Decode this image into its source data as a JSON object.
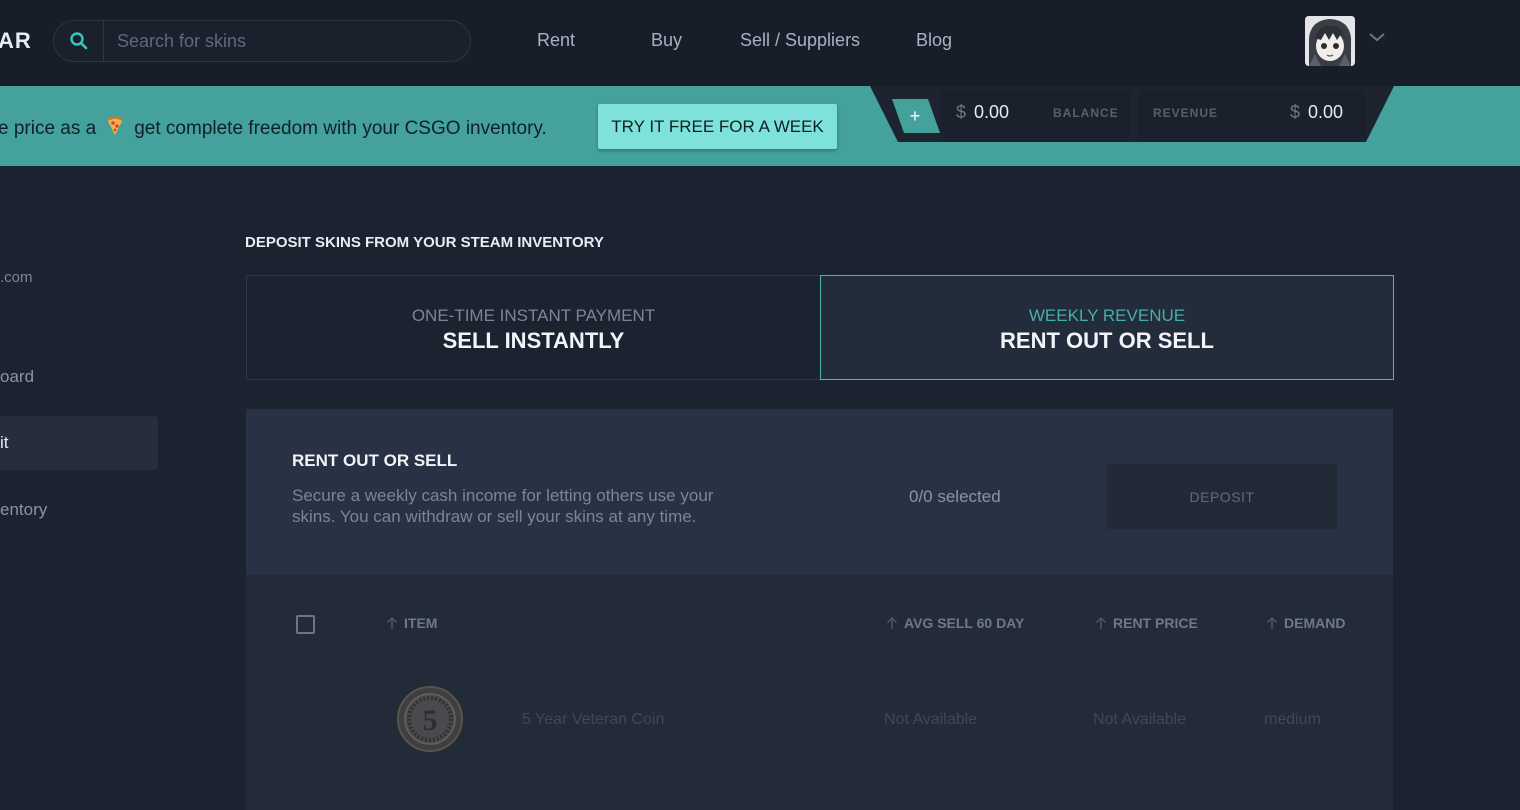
{
  "header": {
    "logo_text": "AR",
    "search_placeholder": "Search for skins",
    "nav": [
      "Rent",
      "Buy",
      "Sell / Suppliers",
      "Blog"
    ]
  },
  "promo": {
    "text_before": "e price as a",
    "text_after": "get complete freedom with your CSGO inventory.",
    "cta_label": "TRY IT FREE FOR A WEEK"
  },
  "wallet": {
    "currency": "$",
    "balance_amount": "0.00",
    "balance_label": "BALANCE",
    "revenue_label": "REVENUE",
    "revenue_amount": "0.00",
    "add_label": "+"
  },
  "sidebar": {
    "email_fragment": ".com",
    "items": [
      "oard",
      "it",
      "entory"
    ]
  },
  "main": {
    "section_title": "DEPOSIT SKINS FROM YOUR STEAM INVENTORY",
    "options": [
      {
        "sub": "ONE-TIME INSTANT PAYMENT",
        "main": "SELL INSTANTLY"
      },
      {
        "sub": "WEEKLY REVENUE",
        "main": "RENT OUT OR SELL"
      }
    ],
    "panel": {
      "title": "RENT OUT OR SELL",
      "description": "Secure a weekly cash income for letting others use your skins. You can withdraw or sell your skins at any time.",
      "selected_text": "0/0 selected",
      "deposit_label": "DEPOSIT"
    },
    "table": {
      "columns": [
        "ITEM",
        "AVG SELL 60 DAY",
        "RENT PRICE",
        "DEMAND"
      ],
      "rows": [
        {
          "item": "5 Year Veteran Coin",
          "avg_sell": "Not Available",
          "rent_price": "Not Available",
          "demand": "medium",
          "coin_glyph": "5"
        }
      ]
    }
  },
  "colors": {
    "accent": "#44a19b",
    "cta": "#7ee2da",
    "background": "#1b2230",
    "header": "#171e2a"
  }
}
